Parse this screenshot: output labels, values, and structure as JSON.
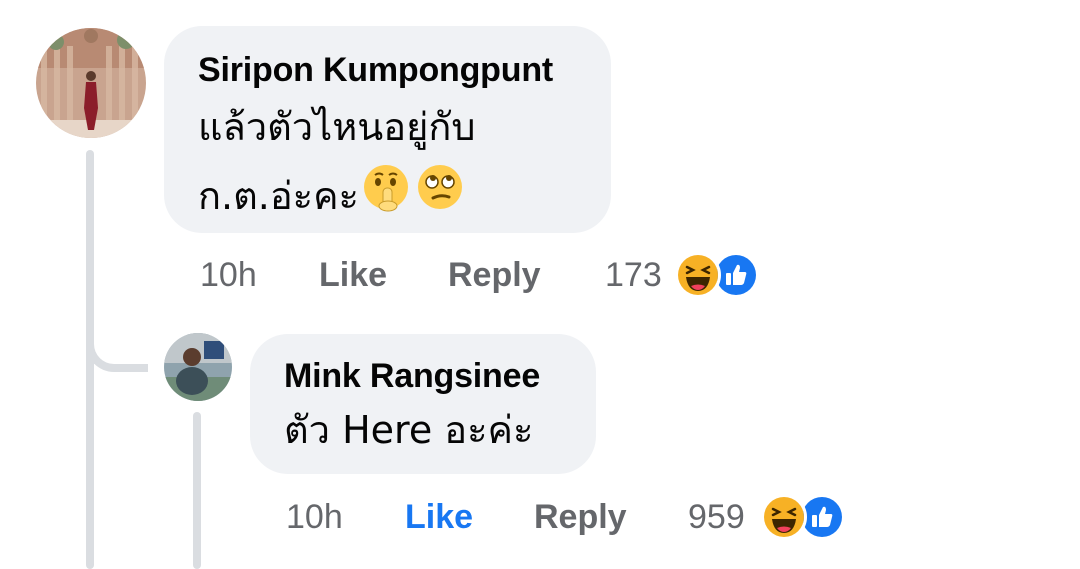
{
  "comments": [
    {
      "author": "Siripon Kumpongpunt",
      "text_line1": "แล้วตัวไหนอยู่กับ",
      "text_line2": "ก.ต.อ่ะคะ",
      "emojis": [
        "shushing-face-icon",
        "face-with-rolling-eyes-icon"
      ],
      "time": "10h",
      "like_label": "Like",
      "reply_label": "Reply",
      "reaction_count": "173",
      "reactions": [
        "haha-icon",
        "like-icon"
      ],
      "liked": false
    },
    {
      "author": "Mink Rangsinee",
      "text": "ตัว Here อะค่ะ",
      "time": "10h",
      "like_label": "Like",
      "reply_label": "Reply",
      "reaction_count": "959",
      "reactions": [
        "haha-icon",
        "like-icon"
      ],
      "liked": true
    }
  ],
  "colors": {
    "bubble": "#f0f2f5",
    "secondary_text": "#65676b",
    "like_active": "#1877f2",
    "thread_line": "#dadde1"
  }
}
